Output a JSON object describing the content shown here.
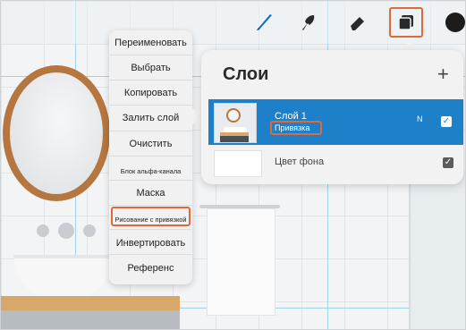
{
  "toolbar": {
    "tools": [
      {
        "name": "brush-icon"
      },
      {
        "name": "smudge-icon"
      },
      {
        "name": "eraser-icon"
      },
      {
        "name": "layers-icon",
        "highlighted": true
      },
      {
        "name": "color-icon"
      }
    ],
    "accent_color": "#e0693a",
    "current_color": "#1c1c1c"
  },
  "layer_menu": {
    "items": [
      {
        "label": "Переименовать"
      },
      {
        "label": "Выбрать"
      },
      {
        "label": "Копировать"
      },
      {
        "label": "Залить слой"
      },
      {
        "label": "Очистить"
      },
      {
        "label": "Блок альфа-канала"
      },
      {
        "label": "Маска"
      },
      {
        "label": "Рисование с привязкой",
        "highlighted": true
      },
      {
        "label": "Инвертировать"
      },
      {
        "label": "Референс"
      }
    ]
  },
  "layers_panel": {
    "title": "Слои",
    "add_icon": "+",
    "layers": [
      {
        "name": "Слой 1",
        "sub_label": "Привязка",
        "blend_mode": "N",
        "visible": true,
        "selected": true
      },
      {
        "name": "Цвет фона",
        "visible": true,
        "selected": false
      }
    ],
    "selected_color": "#1e80c9"
  }
}
